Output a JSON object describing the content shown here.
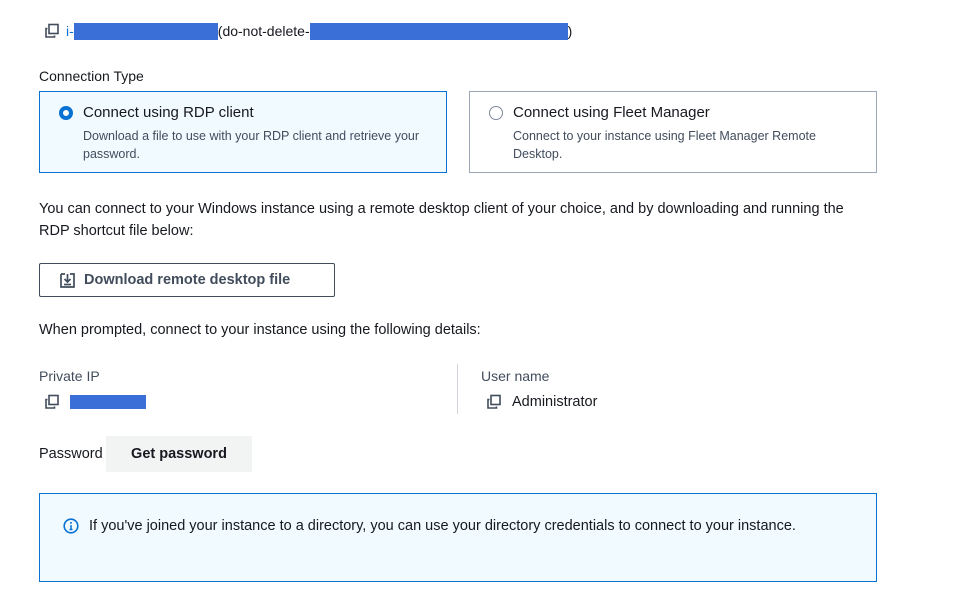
{
  "instance": {
    "id_prefix": "i-",
    "name_prefix": "(do-not-delete-",
    "name_suffix": ")"
  },
  "connection_type": {
    "label": "Connection Type",
    "options": [
      {
        "title": "Connect using RDP client",
        "description": "Download a file to use with your RDP client and retrieve your password.",
        "selected": true
      },
      {
        "title": "Connect using Fleet Manager",
        "description": "Connect to your instance using Fleet Manager Remote Desktop.",
        "selected": false
      }
    ]
  },
  "intro_text": "You can connect to your Windows instance using a remote desktop client of your choice, and by downloading and running the RDP shortcut file below:",
  "download_button": {
    "label": "Download remote desktop file",
    "icon": "download-icon"
  },
  "prompt_text": "When prompted, connect to your instance using the following details:",
  "details": {
    "private_ip": {
      "label": "Private IP"
    },
    "user_name": {
      "label": "User name",
      "value": "Administrator"
    }
  },
  "password": {
    "label": "Password",
    "button_label": "Get password"
  },
  "info": {
    "icon": "info-icon",
    "text": "If you've joined your instance to a directory, you can use your directory credentials to connect to your instance."
  },
  "colors": {
    "accent": "#0972d3",
    "selected_bg": "#f1faff",
    "redaction": "#3a6fd8"
  }
}
